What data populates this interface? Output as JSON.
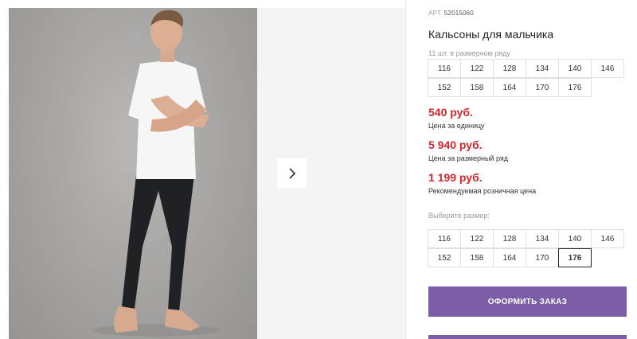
{
  "product": {
    "art_prefix": "АРТ.",
    "art_code": "52015060",
    "title": "Кальсоны для мальчика",
    "row_count_text": "11 шт. в размерном ряду"
  },
  "sizes_row": {
    "row1": [
      "116",
      "122",
      "128",
      "134",
      "140",
      "146"
    ],
    "row2": [
      "152",
      "158",
      "164",
      "170",
      "176"
    ]
  },
  "prices": [
    {
      "value": "540 руб.",
      "label": "Цена за единицу"
    },
    {
      "value": "5 940 руб.",
      "label": "Цена за размерный ряд"
    },
    {
      "value": "1 199 руб.",
      "label": "Рекомендуемая розничная цена"
    }
  ],
  "choose": {
    "label": "Выберите размер:",
    "row1": [
      "116",
      "122",
      "128",
      "134",
      "140",
      "146"
    ],
    "row2": [
      "152",
      "158",
      "164",
      "170",
      "176"
    ],
    "selected": "176"
  },
  "order_button": "ОФОРМИТЬ ЗАКАЗ",
  "icons": {
    "next": "chevron-right-icon"
  },
  "colors": {
    "accent": "#7b5ea7",
    "price": "#d0262c"
  }
}
